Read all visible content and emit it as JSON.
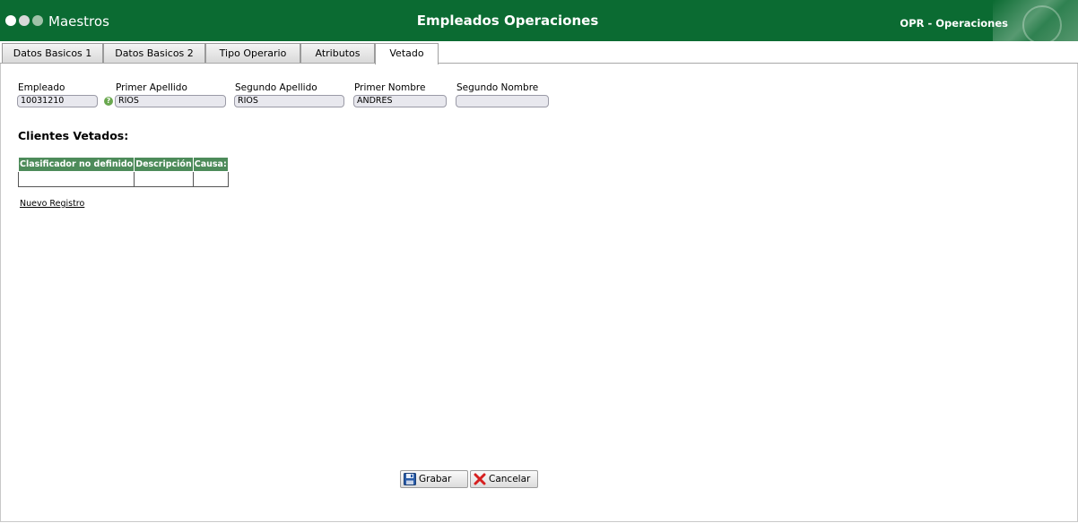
{
  "header": {
    "app_title": "Maestros",
    "page_title": "Empleados Operaciones",
    "module": "OPR - Operaciones",
    "colors": {
      "background": "#0b6b32",
      "dots": [
        "#ffffff",
        "#d8d8d8",
        "#9fc2a8"
      ]
    }
  },
  "tabs": [
    {
      "label": "Datos Basicos 1"
    },
    {
      "label": "Datos Basicos 2"
    },
    {
      "label": "Tipo Operario"
    },
    {
      "label": "Atributos"
    },
    {
      "label": "Vetado",
      "active": true
    }
  ],
  "fields": {
    "empleado": {
      "label": "Empleado",
      "value": "10031210"
    },
    "primer_apellido": {
      "label": "Primer Apellido",
      "value": "RIOS"
    },
    "segundo_apellido": {
      "label": "Segundo Apellido",
      "value": "RIOS"
    },
    "primer_nombre": {
      "label": "Primer Nombre",
      "value": "ANDRES"
    },
    "segundo_nombre": {
      "label": "Segundo Nombre",
      "value": ""
    }
  },
  "help_icon": {
    "glyph": "?",
    "icon": "help-icon"
  },
  "section": {
    "title": "Clientes Vetados:"
  },
  "table": {
    "columns": [
      "Clasificador no definido",
      "Descripción",
      "Causa:"
    ],
    "header_color": "#4d8b5a"
  },
  "new_record_link": "Nuevo Registro",
  "buttons": {
    "save": {
      "label": "Grabar",
      "icon": "floppy-disk-icon"
    },
    "cancel": {
      "label": "Cancelar",
      "icon": "red-x-icon"
    }
  }
}
